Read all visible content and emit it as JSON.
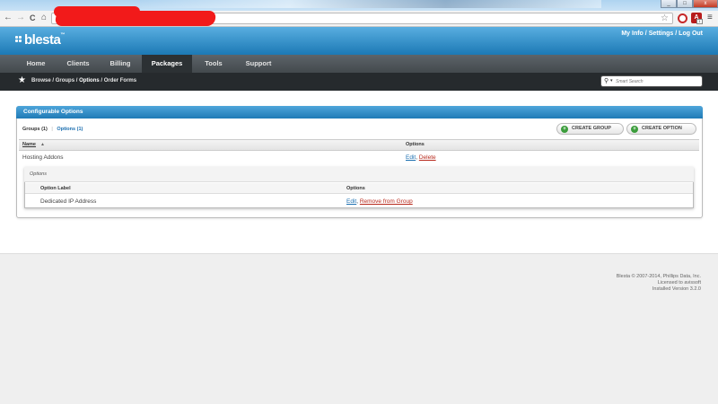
{
  "browser": {
    "window_buttons": [
      "_",
      "□",
      "x"
    ],
    "back_glyph": "←",
    "forward_glyph": "→",
    "reload_glyph": "C",
    "home_glyph": "⌂",
    "bookmark_glyph": "☆",
    "menu_glyph": "≡",
    "ext_label": "A",
    "ext_badge": "1",
    "icons": [
      "back-icon",
      "forward-icon",
      "reload-icon",
      "home-icon",
      "bookmark-star-icon",
      "menu-icon"
    ]
  },
  "header": {
    "logo": "blesta",
    "logo_tm": "™",
    "links": {
      "my_info": "My Info",
      "settings": "Settings",
      "logout": "Log Out"
    },
    "sep": "/"
  },
  "nav": {
    "items": [
      "Home",
      "Clients",
      "Billing",
      "Packages",
      "Tools",
      "Support"
    ],
    "active": "Packages"
  },
  "subnav": {
    "breadcrumb": {
      "browse": "Browse",
      "groups": "Groups",
      "options": "Options",
      "order_forms": "Order Forms",
      "sep": " / "
    },
    "search_placeholder": "Smart Search"
  },
  "panel": {
    "title": "Configurable Options",
    "tabs": {
      "groups": "Groups (1)",
      "options": "Options (1)",
      "sep": "|"
    },
    "buttons": {
      "create_group": "CREATE GROUP",
      "create_option": "CREATE OPTION"
    },
    "table": {
      "headers": {
        "name": "Name",
        "name_sort": "▲",
        "options": "Options"
      },
      "rows": [
        {
          "name": "Hosting Addons",
          "edit": "Edit",
          "delete": "Delete"
        }
      ]
    },
    "subtable": {
      "title": "Options",
      "headers": {
        "label": "Option Label",
        "options": "Options"
      },
      "rows": [
        {
          "label": "Dedicated IP Address",
          "edit": "Edit",
          "remove": "Remove from Group"
        }
      ]
    }
  },
  "footer": {
    "line1": "Blesta © 2007-2014, Phillips Data, Inc.",
    "line2": "Licensed to avissoft",
    "line3": "Installed Version 3.2.0"
  },
  "colors": {
    "header_blue": "#1c79b5",
    "nav_dark": "#43494d",
    "link_blue": "#1c6fb0",
    "link_red": "#b7291c",
    "redaction": "#f21a1a"
  }
}
